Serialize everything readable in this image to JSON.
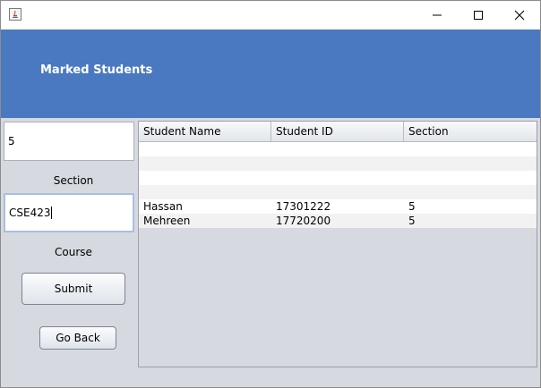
{
  "window": {
    "icon": "java-icon",
    "controls": [
      "minimize-icon",
      "maximize-icon",
      "close-icon"
    ]
  },
  "header": {
    "title": "Marked Students"
  },
  "form": {
    "section_value": "5",
    "section_label": "Section",
    "course_value": "CSE423",
    "course_label": "Course",
    "submit_label": "Submit",
    "back_label": "Go Back"
  },
  "table": {
    "columns": [
      "Student Name",
      "Student ID",
      "Section"
    ],
    "rows": [
      [
        "",
        "",
        ""
      ],
      [
        "",
        "",
        ""
      ],
      [
        "",
        "",
        ""
      ],
      [
        "",
        "",
        ""
      ],
      [
        "Hassan",
        "17301222",
        "5"
      ],
      [
        "Mehreen",
        "17720200",
        "5"
      ]
    ]
  }
}
